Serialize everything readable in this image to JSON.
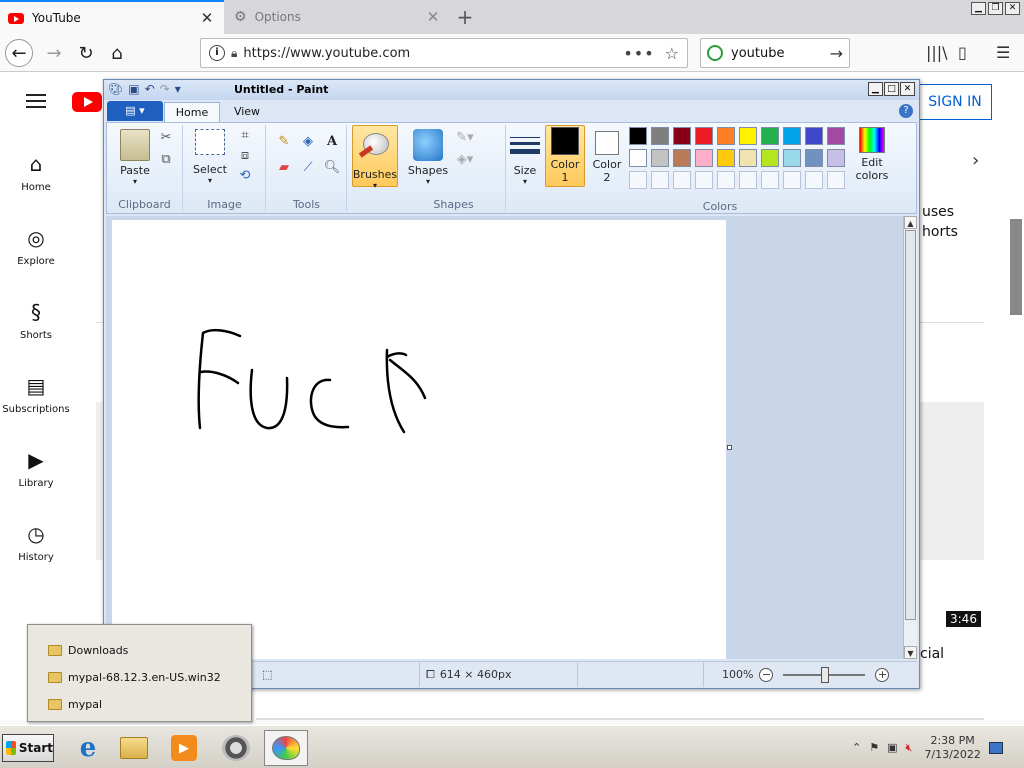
{
  "browser": {
    "tabs": [
      {
        "title": "YouTube",
        "active": true
      },
      {
        "title": "Options",
        "active": false
      }
    ],
    "url": "https://www.youtube.com",
    "search": "youtube"
  },
  "youtube": {
    "signin": "SIGN IN",
    "nav": [
      {
        "label": "Home",
        "icon": "home-icon"
      },
      {
        "label": "Explore",
        "icon": "compass-icon"
      },
      {
        "label": "Shorts",
        "icon": "shorts-icon"
      },
      {
        "label": "Subscriptions",
        "icon": "subscriptions-icon"
      },
      {
        "label": "Library",
        "icon": "library-icon"
      },
      {
        "label": "History",
        "icon": "history-icon"
      }
    ],
    "partial_text_1": "uses",
    "partial_text_2": "horts",
    "duration": "3:46",
    "partial_text_3": "cial"
  },
  "paint": {
    "title": "Untitled - Paint",
    "tabs": {
      "home": "Home",
      "view": "View"
    },
    "groups": {
      "clipboard": "Clipboard",
      "image": "Image",
      "tools": "Tools",
      "shapes": "Shapes",
      "colors": "Colors"
    },
    "buttons": {
      "paste": "Paste",
      "select": "Select",
      "brushes": "Brushes",
      "shapes": "Shapes",
      "size": "Size",
      "color1_a": "Color",
      "color1_b": "1",
      "color2_a": "Color",
      "color2_b": "2",
      "edit_colors_a": "Edit",
      "edit_colors_b": "colors"
    },
    "colors": {
      "color1": "#000000",
      "color2": "#ffffff",
      "palette_row1": [
        "#000000",
        "#7f7f7f",
        "#880015",
        "#ed1c24",
        "#ff7f27",
        "#fff200",
        "#22b14c",
        "#00a2e8",
        "#3f48cc",
        "#a349a4"
      ],
      "palette_row2": [
        "#ffffff",
        "#c3c3c3",
        "#b97a57",
        "#ffaec9",
        "#ffc90e",
        "#efe4b0",
        "#b5e61d",
        "#99d9ea",
        "#7092be",
        "#c8bfe7"
      ]
    },
    "status": {
      "image_size": "614 × 460px",
      "zoom": "100%"
    }
  },
  "jumplist": {
    "items": [
      "Downloads",
      "mypal-68.12.3.en-US.win32",
      "mypal"
    ]
  },
  "taskbar": {
    "start": "Start",
    "time": "2:38 PM",
    "date": "7/13/2022"
  }
}
